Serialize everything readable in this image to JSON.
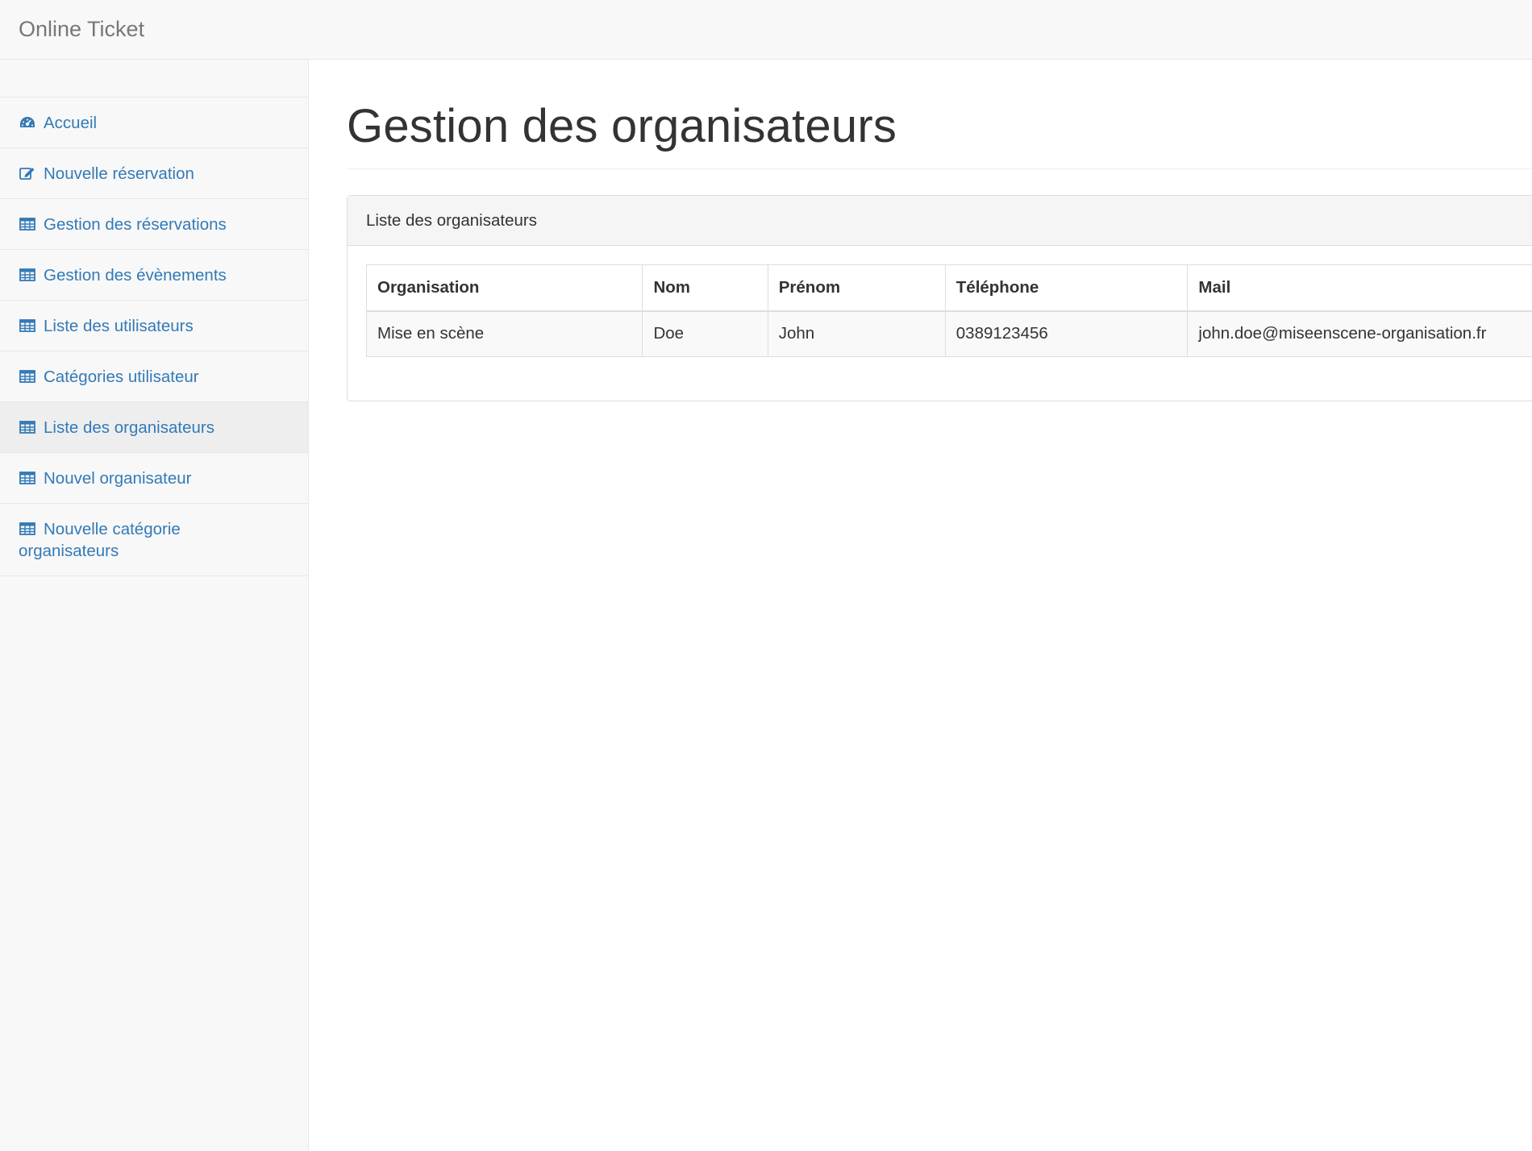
{
  "navbar": {
    "brand": "Online Ticket"
  },
  "sidebar": {
    "items": [
      {
        "label": "Accueil",
        "icon": "dashboard-icon",
        "active": false
      },
      {
        "label": "Nouvelle réservation",
        "icon": "edit-icon",
        "active": false
      },
      {
        "label": "Gestion des réservations",
        "icon": "table-icon",
        "active": false
      },
      {
        "label": "Gestion des évènements",
        "icon": "table-icon",
        "active": false
      },
      {
        "label": "Liste des utilisateurs",
        "icon": "table-icon",
        "active": false
      },
      {
        "label": "Catégories utilisateur",
        "icon": "table-icon",
        "active": false
      },
      {
        "label": "Liste des organisateurs",
        "icon": "table-icon",
        "active": true
      },
      {
        "label": "Nouvel organisateur",
        "icon": "table-icon",
        "active": false
      },
      {
        "label": "Nouvelle catégorie organisateurs",
        "icon": "table-icon",
        "active": false
      }
    ]
  },
  "main": {
    "title": "Gestion des organisateurs",
    "panel": {
      "heading": "Liste des organisateurs",
      "table": {
        "columns": [
          "Organisation",
          "Nom",
          "Prénom",
          "Téléphone",
          "Mail"
        ],
        "rows": [
          [
            "Mise en scène",
            "Doe",
            "John",
            "0389123456",
            "john.doe@miseenscene-organisation.fr"
          ]
        ]
      }
    }
  },
  "colors": {
    "link": "#337ab7",
    "navbar_bg": "#f8f8f8",
    "active_item_bg": "#eeeeee",
    "border": "#dddddd"
  }
}
